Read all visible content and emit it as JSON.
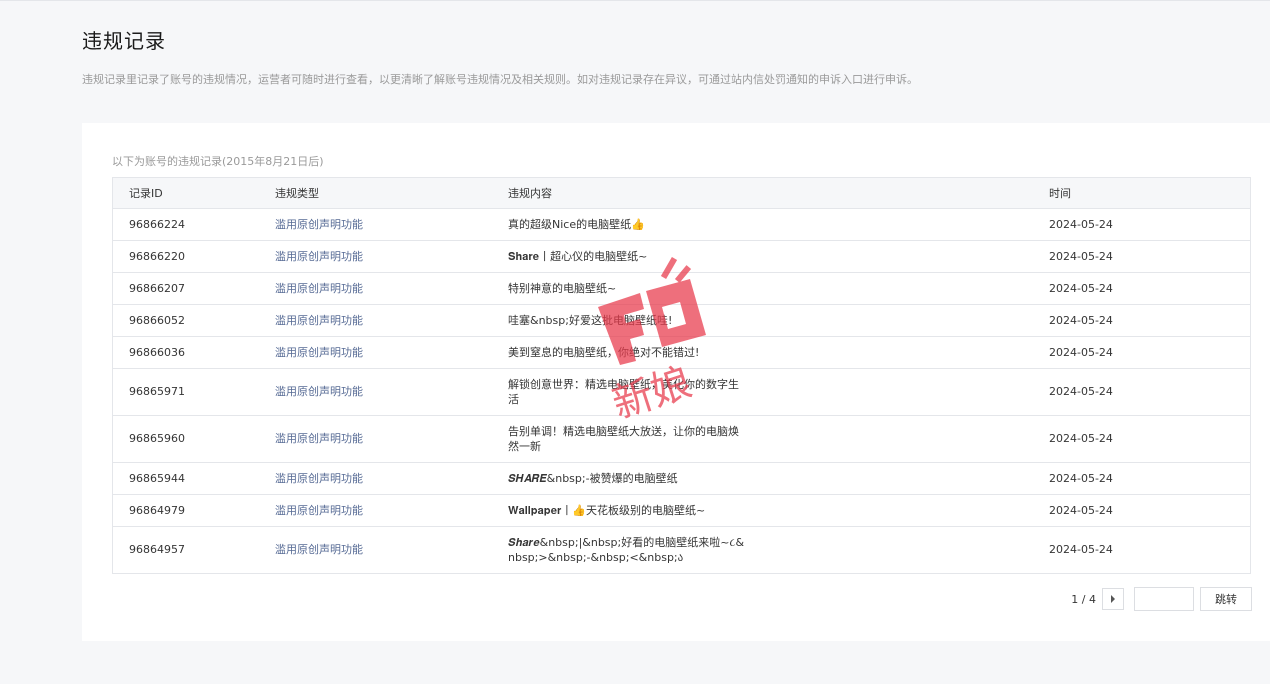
{
  "header": {
    "title": "违规记录",
    "description": "违规记录里记录了账号的违规情况，运营者可随时进行查看，以更清晰了解账号违规情况及相关规则。如对违规记录存在异议，可通过站内信处罚通知的申诉入口进行申诉。"
  },
  "table": {
    "caption": "以下为账号的违规记录(2015年8月21日后)",
    "columns": [
      "记录ID",
      "违规类型",
      "违规内容",
      "时间"
    ],
    "rows": [
      {
        "id": "96866224",
        "type": "滥用原创声明功能",
        "content": "真的超级Nice的电脑壁纸&#x1f44d;",
        "time": "2024-05-24"
      },
      {
        "id": "96866220",
        "type": "滥用原创声明功能",
        "content": "𝐒𝐡𝐚𝐫𝐞丨超心仪的电脑壁纸~",
        "time": "2024-05-24"
      },
      {
        "id": "96866207",
        "type": "滥用原创声明功能",
        "content": "特别神意的电脑壁纸~",
        "time": "2024-05-24"
      },
      {
        "id": "96866052",
        "type": "滥用原创声明功能",
        "content": "哇塞&nbsp;好爱这批电脑壁纸哇!",
        "time": "2024-05-24"
      },
      {
        "id": "96866036",
        "type": "滥用原创声明功能",
        "content": "美到窒息的电脑壁纸，你绝对不能错过!",
        "time": "2024-05-24"
      },
      {
        "id": "96865971",
        "type": "滥用原创声明功能",
        "content": "解锁创意世界：精选电脑壁纸，美化你的数字生活",
        "time": "2024-05-24"
      },
      {
        "id": "96865960",
        "type": "滥用原创声明功能",
        "content": "告别单调！精选电脑壁纸大放送，让你的电脑焕然一新",
        "time": "2024-05-24"
      },
      {
        "id": "96865944",
        "type": "滥用原创声明功能",
        "content": "𝑺𝑯𝑨𝑹𝑬&nbsp;-被赞爆的电脑壁纸",
        "time": "2024-05-24"
      },
      {
        "id": "96864979",
        "type": "滥用原创声明功能",
        "content": "𝐖𝐚𝐥𝐥𝐩𝐚𝐩𝐞𝐫丨&#x1f44d;天花板级别的电脑壁纸~",
        "time": "2024-05-24"
      },
      {
        "id": "96864957",
        "type": "滥用原创声明功能",
        "content": "𝑺𝒉𝒂𝒓𝒆&nbsp;|&nbsp;好看的电脑壁纸来啦~૮&nbsp;>&nbsp;-&nbsp;<&nbsp;ა",
        "time": "2024-05-24"
      }
    ]
  },
  "pager": {
    "page_text": "1 / 4",
    "input_value": "",
    "go_label": "跳转"
  },
  "watermark": {
    "text": "新娘"
  },
  "colors": {
    "background": "#f6f7f9",
    "card": "#ffffff",
    "link_blue": "#576b95",
    "watermark_red": "#e8394a"
  }
}
